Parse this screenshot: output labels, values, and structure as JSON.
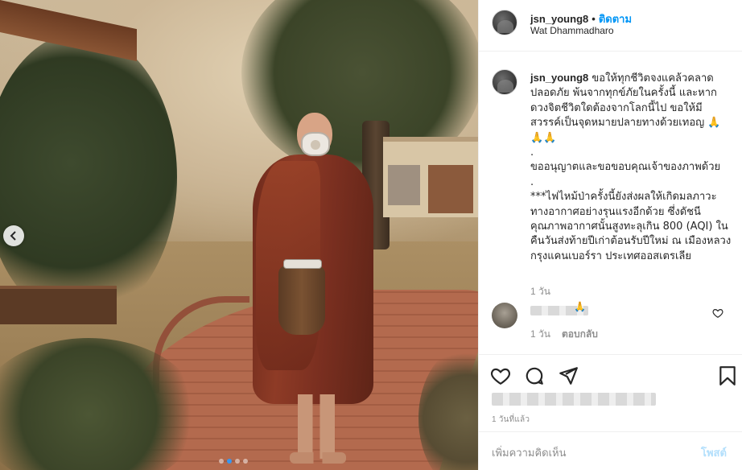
{
  "header": {
    "username": "jsn_young8",
    "separator": "•",
    "follow_label": "ติดตาม",
    "location": "Wat Dhammadharo"
  },
  "caption": {
    "username": "jsn_young8",
    "text": " ขอให้ทุกชีวิตจงแคล้วคลาดปลอดภัย พ้นจากทุกข์ภัยในครั้งนี้ และหากดวงจิตชีวิตใดต้องจากโลกนี้ไป ขอให้มีสวรรค์เป็นจุดหมายปลายทางด้วยเทอญ 🙏🙏🙏\n.\nขออนุญาตและขอขอบคุณเจ้าของภาพด้วย\n.\n***ไฟไหม้ป่าครั้งนี้ยังส่งผลให้เกิดมลภาวะทางอากาศอย่างรุนแรงอีกด้วย ซึ่งดัชนีคุณภาพอากาศนั้นสูงทะลุเกิน 800 (AQI) ในคืนวันส่งท้ายปีเก่าต้อนรับปีใหม่ ณ เมืองหลวงกรุงแคนเบอร์รา ประเทศออสเตรเลีย",
    "time": "1 วัน"
  },
  "comment": {
    "emoji": "🙏",
    "time": "1 วัน",
    "reply_label": "ตอบกลับ"
  },
  "post": {
    "time": "1 วันที่แล้ว",
    "carousel_slide_index": 1,
    "carousel_slide_count": 4
  },
  "input": {
    "placeholder": "เพิ่มความคิดเห็น",
    "post_label": "โพสต์"
  },
  "icons": {
    "like": "heart-icon",
    "comment": "comment-icon",
    "share": "share-icon",
    "save": "bookmark-icon",
    "prev": "chevron-left-icon"
  },
  "colors": {
    "accent": "#0095f6",
    "post_disabled": "#b2dffc",
    "muted": "#8e8e8e",
    "carousel_active": "#3897f0"
  }
}
